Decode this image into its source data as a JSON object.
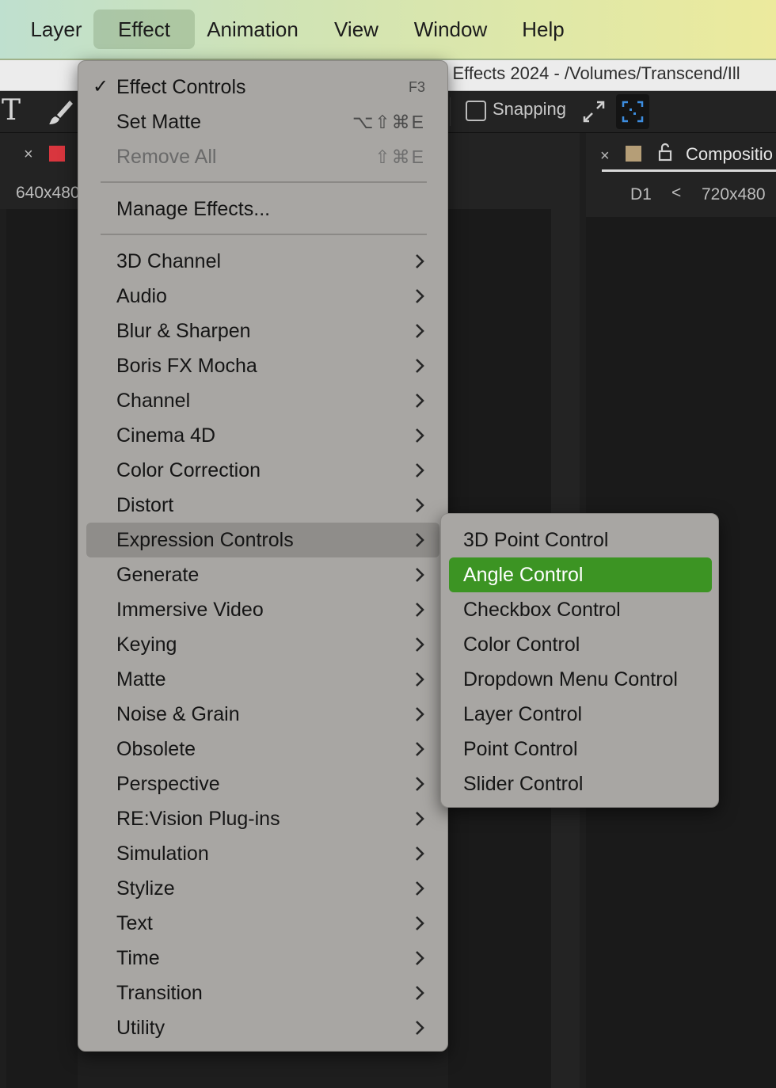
{
  "menubar": {
    "items": [
      "Layer",
      "Effect",
      "Animation",
      "View",
      "Window",
      "Help"
    ],
    "active": "Effect"
  },
  "window": {
    "title": "r Effects 2024 - /Volumes/Transcend/Ill"
  },
  "toolbar": {
    "text_tool": "T",
    "snapping_label": "Snapping"
  },
  "left_panel": {
    "close": "×",
    "resolution": "640x480"
  },
  "right_panel": {
    "close": "×",
    "tab_label": "Compositio",
    "preset": "D1",
    "chevron": "<",
    "resolution": "720x480"
  },
  "effect_menu": {
    "effect_controls": {
      "label": "Effect Controls",
      "shortcut": "F3",
      "checked": "✓"
    },
    "set_matte": {
      "label": "Set Matte",
      "shortcut": "⌥⇧⌘E"
    },
    "remove_all": {
      "label": "Remove All",
      "shortcut": "⇧⌘E"
    },
    "manage_effects": {
      "label": "Manage Effects..."
    },
    "categories": [
      "3D Channel",
      "Audio",
      "Blur & Sharpen",
      "Boris FX Mocha",
      "Channel",
      "Cinema 4D",
      "Color Correction",
      "Distort",
      "Expression Controls",
      "Generate",
      "Immersive Video",
      "Keying",
      "Matte",
      "Noise & Grain",
      "Obsolete",
      "Perspective",
      "RE:Vision Plug-ins",
      "Simulation",
      "Stylize",
      "Text",
      "Time",
      "Transition",
      "Utility"
    ],
    "highlighted_category": "Expression Controls"
  },
  "expression_controls_submenu": {
    "items": [
      "3D Point Control",
      "Angle Control",
      "Checkbox Control",
      "Color Control",
      "Dropdown Menu Control",
      "Layer Control",
      "Point Control",
      "Slider Control"
    ],
    "selected": "Angle Control",
    "selected_color": "#3c9423"
  }
}
